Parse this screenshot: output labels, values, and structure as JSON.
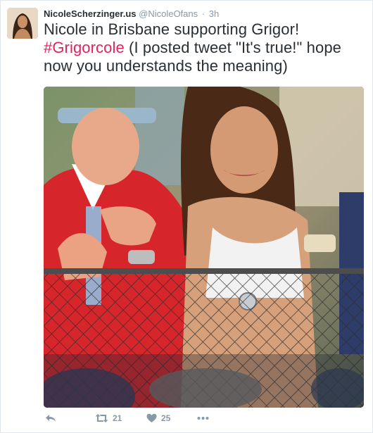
{
  "tweet": {
    "display_name": "NicoleScherzinger.us",
    "handle": "@NicoleOfans",
    "separator": "·",
    "timestamp": "3h",
    "text_part1": "Nicole in Brisbane supporting Grigor!",
    "hashtag": "#Grigorcole",
    "text_part2": " (I posted tweet \"It's true!\" hope now you understands the meaning)"
  },
  "actions": {
    "reply_icon": "reply-icon",
    "retweet_icon": "retweet-icon",
    "retweet_count": "21",
    "like_icon": "heart-icon",
    "like_count": "25",
    "more_icon": "more-icon"
  },
  "colors": {
    "hashtag": "#e0245e",
    "meta_gray": "#8899a6",
    "text": "#292f33",
    "border": "#e1e8ed"
  }
}
